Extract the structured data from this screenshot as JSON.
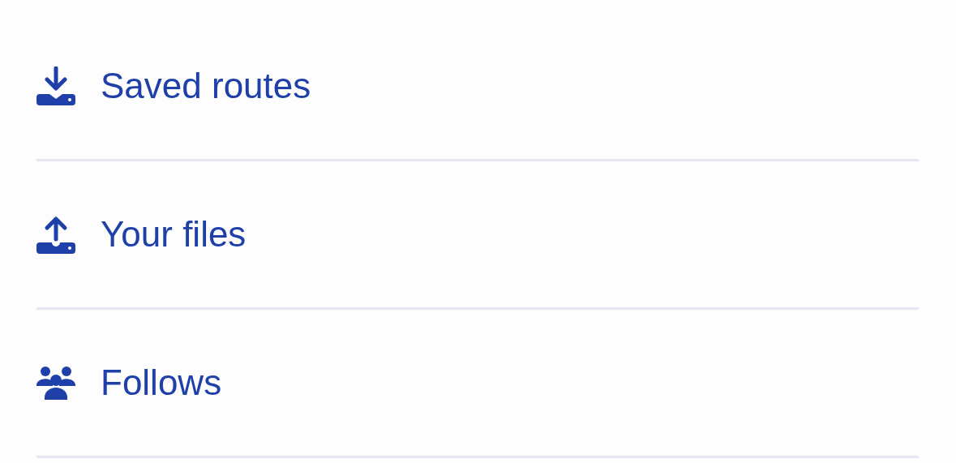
{
  "menu": {
    "items": [
      {
        "label": "Saved routes"
      },
      {
        "label": "Your files"
      },
      {
        "label": "Follows"
      }
    ]
  }
}
